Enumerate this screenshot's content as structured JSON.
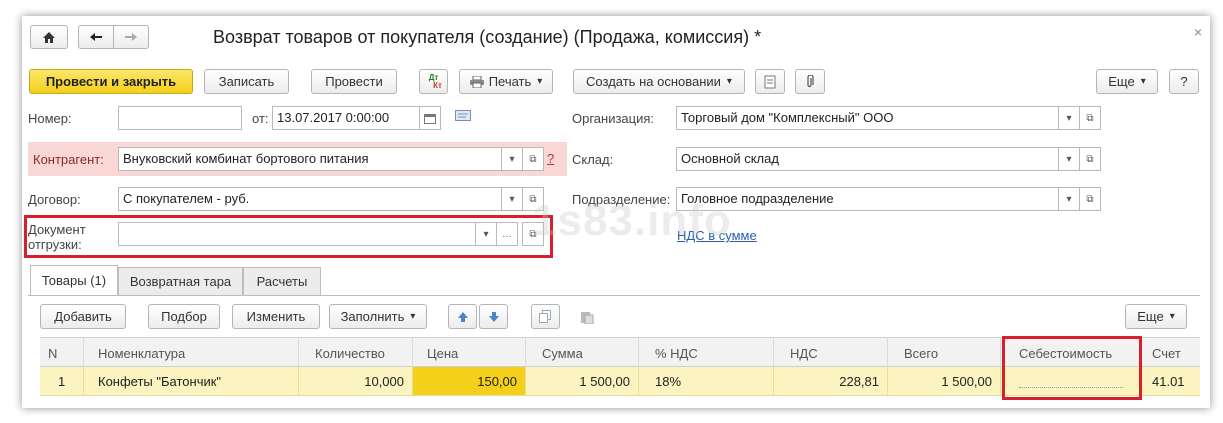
{
  "window": {
    "title": "Возврат товаров от покупателя (создание) (Продажа, комиссия) *",
    "close_glyph": "×"
  },
  "nav": {
    "home_icon": "home-icon",
    "back_icon": "arrow-left-icon",
    "forward_icon": "arrow-right-icon"
  },
  "toolbar": {
    "post_close": "Провести и закрыть",
    "save": "Записать",
    "post": "Провести",
    "dtkt_top": "Дт",
    "dtkt_bottom": "Кт",
    "print": "Печать",
    "create_based": "Создать на основании",
    "more": "Еще",
    "help": "?"
  },
  "header": {
    "number_label": "Номер:",
    "number_value": "",
    "date_label": "от:",
    "date_value": "13.07.2017  0:00:00",
    "org_label": "Организация:",
    "org_value": "Торговый дом \"Комплексный\" ООО",
    "contractor_label": "Контрагент:",
    "contractor_value": "Внуковский комбинат бортового питания",
    "contractor_help": "?",
    "warehouse_label": "Склад:",
    "warehouse_value": "Основной склад",
    "contract_label": "Договор:",
    "contract_value": "С покупателем - руб.",
    "department_label": "Подразделение:",
    "department_value": "Головное подразделение",
    "shipment_doc_label_1": "Документ",
    "shipment_doc_label_2": "отгрузки:",
    "shipment_doc_value": "",
    "vat_link": "НДС в сумме",
    "watermark": "1s83.info"
  },
  "tabs": [
    {
      "label": "Товары (1)",
      "active": true
    },
    {
      "label": "Возвратная тара",
      "active": false
    },
    {
      "label": "Расчеты",
      "active": false
    }
  ],
  "table_toolbar": {
    "add": "Добавить",
    "pick": "Подбор",
    "edit": "Изменить",
    "fill": "Заполнить",
    "more": "Еще"
  },
  "table": {
    "columns": [
      "N",
      "Номенклатура",
      "Количество",
      "Цена",
      "Сумма",
      "% НДС",
      "НДС",
      "Всего",
      "Себестоимость",
      "Счет"
    ],
    "rows": [
      [
        "1",
        "Конфеты \"Батончик\"",
        "10,000",
        "150,00",
        "1 500,00",
        "18%",
        "228,81",
        "1 500,00",
        "",
        "41.01"
      ]
    ]
  },
  "colors": {
    "accent_yellow": "#f4d01a",
    "highlight_red": "#d8202a",
    "row_highlight": "#fbf3c0",
    "link_blue": "#2a5db0"
  }
}
